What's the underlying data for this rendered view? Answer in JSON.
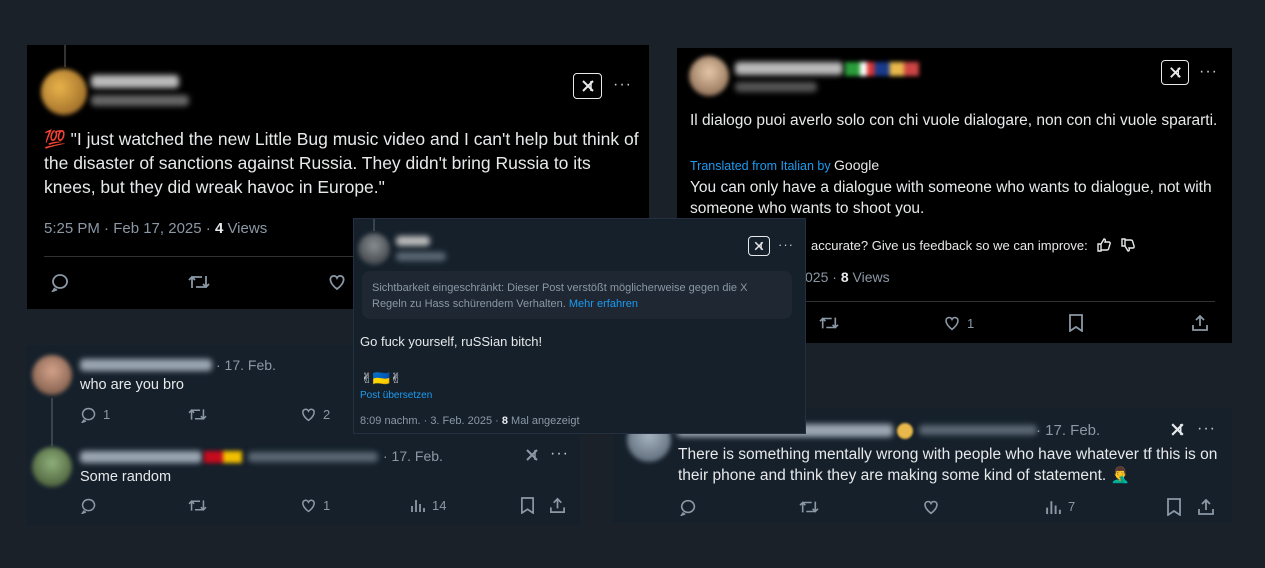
{
  "card1": {
    "emoji": "💯",
    "text": "\"I just watched the new Little Bug music video and I can't help but think of the disaster of sanctions against Russia. They didn't bring Russia to its knees, but they did wreak havoc in Europe.\"",
    "time": "5:25 PM · Feb 17, 2025 · ",
    "views_count": "4",
    "views_label": " Views"
  },
  "card2": {
    "original": "Il dialogo puoi averlo solo con chi vuole dialogare, non con chi vuole spararti.",
    "translated_from": "Translated from Italian by ",
    "google": "Google",
    "translation": "You can only have a dialogue with someone who wants to dialogue, not with someone who wants to shoot you.",
    "feedback": "accurate? Give us feedback so we can improve:",
    "time": "025 · ",
    "views_count": "8",
    "views_label": " Views",
    "likes": "1"
  },
  "card3": {
    "post1": {
      "date": "· 17. Feb.",
      "text": "who are you bro",
      "replies": "1",
      "likes": "2"
    },
    "post2": {
      "date": "· 17. Feb.",
      "text": "Some random",
      "likes": "1",
      "views": "14"
    }
  },
  "card4": {
    "warning": "Sichtbarkeit eingeschränkt: Dieser Post verstößt möglicherweise gegen die X Regeln zu Hass schürendem Verhalten. ",
    "learn_more": "Mehr erfahren",
    "text": "Go fuck yourself, ruSSian bitch!",
    "emojis": "✌🇺🇦✌",
    "translate": "Post übersetzen",
    "time": "8:09 nachm. · 3. Feb. 2025 · ",
    "views_count": "8",
    "views_label": " Mal angezeigt"
  },
  "card5": {
    "date": "· 17. Feb.",
    "text": "There is something mentally wrong with people who have whatever tf this is on their phone and think they are making some kind of statement. 🤦‍♂️",
    "views": "7"
  }
}
